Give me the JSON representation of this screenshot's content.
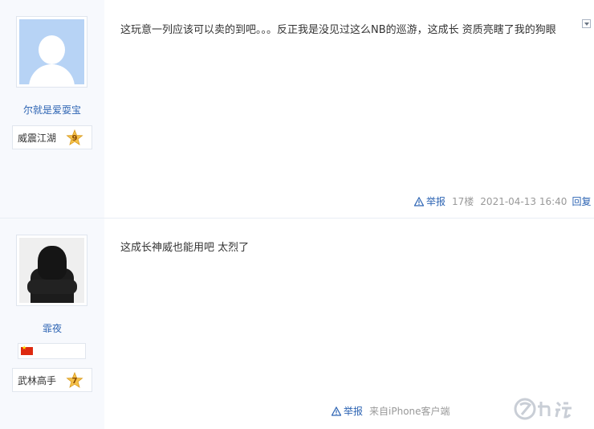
{
  "posts": [
    {
      "username": "尔就是爱耍宝",
      "rank_title": "威震江湖",
      "rank_level": "9",
      "content": "这玩意一列应该可以卖的到吧。。。反正我是没见过这么NB的巡游，这成长 资质亮瞎了我的狗眼",
      "report_label": "举报",
      "floor": "17楼",
      "timestamp": "2021-04-13 16:40",
      "reply_label": "回复"
    },
    {
      "username": "霏夜",
      "rank_title": "武林高手",
      "rank_level": "7",
      "content": "这成长神威也能用吧 太烈了",
      "report_label": "举报",
      "source": "来自iPhone客户端"
    }
  ],
  "colors": {
    "link": "#2d64b3",
    "sidebar_bg": "#f7f9fd",
    "meta_gray": "#999999",
    "rank_star": "#f5c24a"
  },
  "icons": {
    "report": "warning-triangle-icon",
    "dropdown": "chevron-down-icon",
    "flag": "china-flag-icon",
    "watermark": "jiuyou-logo"
  }
}
